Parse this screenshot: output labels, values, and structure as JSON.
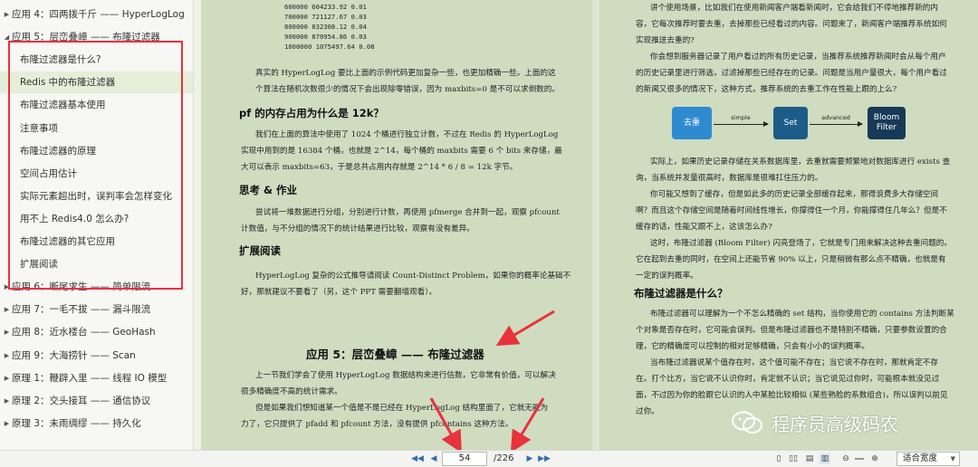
{
  "toc": {
    "items": [
      {
        "label": "应用 4：四两拨千斤 —— HyperLogLog",
        "arrow": "▶",
        "level": 0
      },
      {
        "label": "应用 5：层峦叠嶂 —— 布隆过滤器",
        "arrow": "◢",
        "level": 0
      },
      {
        "label": "布隆过滤器是什么?",
        "level": 1
      },
      {
        "label": "Redis 中的布隆过滤器",
        "level": 1,
        "active": true
      },
      {
        "label": "布隆过滤器基本使用",
        "level": 1
      },
      {
        "label": "注意事项",
        "level": 1
      },
      {
        "label": "布隆过滤器的原理",
        "level": 1
      },
      {
        "label": "空间占用估计",
        "level": 1
      },
      {
        "label": "实际元素超出时，误判率会怎样变化",
        "level": 1
      },
      {
        "label": "用不上 Redis4.0 怎么办?",
        "level": 1
      },
      {
        "label": "布隆过滤器的其它应用",
        "level": 1
      },
      {
        "label": "扩展阅读",
        "level": 1
      },
      {
        "label": "应用 6：断尾求生 —— 简单限流",
        "arrow": "▶",
        "level": 0
      },
      {
        "label": "应用 7：一毛不拔 —— 漏斗限流",
        "arrow": "▶",
        "level": 0
      },
      {
        "label": "应用 8：近水楼台 —— GeoHash",
        "arrow": "▶",
        "level": 0
      },
      {
        "label": "应用 9：大海捞针 —— Scan",
        "arrow": "▶",
        "level": 0
      },
      {
        "label": "原理 1：鞭辟入里 —— 线程 IO 模型",
        "arrow": "▶",
        "level": 0
      },
      {
        "label": "原理 2：交头接耳 —— 通信协议",
        "arrow": "▶",
        "level": 0
      },
      {
        "label": "原理 3：未雨绸缪 —— 持久化",
        "arrow": "▶",
        "level": 0
      }
    ]
  },
  "left_page": {
    "code_lines": [
      "600000 604233.92 0.01",
      "700000 721127.67 0.03",
      "800000 832308.12 0.04",
      "900000 870954.86 0.03",
      "1000000 1075497.64 0.08"
    ],
    "para1": [
      "真实的 HyperLogLog 要比上面的示例代码更加复杂一些，也更加精确一些。上面的这",
      "个算法在随机次数很少的情况下会出现除零错误，因为 maxbits=0 是不可以求倒数的。"
    ],
    "heading_pf": "pf 的内存占用为什么是 12k？",
    "para2": [
      "我们在上面的算法中使用了 1024 个桶进行独立计数，不过在 Redis 的 HyperLogLog",
      "实现中用到的是 16384 个桶，也就是 2^14，每个桶的 maxbits 需要 6 个 bits 来存储，最",
      "大可以表示 maxbits=63，于是总共占用内存就是 2^14 * 6 / 8 = 12k 字节。"
    ],
    "heading_think": "思考 & 作业",
    "para3": [
      "尝试将一堆数据进行分组，分别进行计数，再使用 pfmerge 合并到一起，观察 pfcount",
      "计数值，与不分组的情况下的统计结果进行比较，观察有没有差异。"
    ],
    "heading_ext": "扩展阅读",
    "para4": [
      "HyperLogLog 复杂的公式推导请阅读 Count-Distinct Problem，如果你的概率论基础不",
      "好，那就建议不要看了（另，这个 PPT 需要翻墙观看）。"
    ],
    "chapter_title": "应用 5：层峦叠嶂 —— 布隆过滤器",
    "para5": [
      "上一节我们学会了使用 HyperLogLog 数据结构来进行估数，它非常有价值，可以解决",
      "很多精确度不高的统计需求。",
      "但是如果我们想知道某一个值是不是已经在 HyperLogLog 结构里面了，它就无能为",
      "力了，它只提供了 pfadd 和 pfcount 方法，没有提供 pfcontains 这种方法。"
    ]
  },
  "right_page": {
    "para1": [
      "讲个使用场景，比如我们在使用新闻客户端看新闻时，它会给我们不停地推荐新的内",
      "容，它每次推荐时要去重，去掉那些已经看过的内容。问题来了，新闻客户端推荐系统如何",
      "实现推送去重的?",
      "你会想到服务器记录了用户看过的所有历史记录，当推荐系统推荐新闻时会从每个用户",
      "的历史记录里进行筛选，过滤掉那些已经存在的记录。问题是当用户量很大，每个用户看过",
      "的新闻又很多的情况下，这种方式，推荐系统的去重工作在性能上跟的上么?"
    ],
    "diagram": {
      "box1": "去重",
      "box2": "Set",
      "box3": "Bloom\nFilter",
      "arrow1": "simple",
      "arrow2": "advanced",
      "color1": "#2f8bd0",
      "color2": "#1d5c89",
      "color3": "#163a57"
    },
    "para2": [
      "实际上，如果历史记录存储在关系数据库里，去重就需要频繁地对数据库进行 exists 查",
      "询，当系统并发量很高时，数据库是很难扛住压力的。",
      "你可能又想到了缓存，但是如此多的历史记录全部缓存起来，那得浪费多大存储空间",
      "啊？而且这个存储空间是随着时间线性增长，你撑得住一个月，你能撑得住几年么？但是不",
      "缓存的话，性能又跟不上，这该怎么办?",
      "这时，布隆过滤器 (Bloom Filter) 闪亮登场了，它就是专门用来解决这种去重问题的。",
      "它在起到去重的同时，在空间上还能节省 90% 以上，只是稍微有那么点不精确，也就是有",
      "一定的误判概率。"
    ],
    "heading": "布隆过滤器是什么？",
    "para3": [
      "布隆过滤器可以理解为一个不怎么精确的 set 结构，当你使用它的 contains 方法判断某",
      "个对象是否存在时，它可能会误判。但是布隆过滤器也不是特别不精确，只要参数设置的合",
      "理，它的精确度可以控制的相对足够精确，只会有小小的误判概率。",
      "当布隆过滤器说某个值存在时，这个值可能不存在；当它说不存在时，那就肯定不存",
      "在。打个比方，当它说不认识你时，肯定就不认识；当它说见过你时，可能根本就没见过",
      "面，不过因为你的脸跟它认识的人中某脸比较相似 (某些熟脸的系数组合)，所以误判以前见",
      "过你。"
    ]
  },
  "watermark": "程序员高级码农",
  "bottom": {
    "first_btn": "◀◀",
    "prev_btn": "◀",
    "page": "54",
    "total": "/226",
    "next_btn": "▶",
    "last_btn": "▶▶",
    "zoom": "适合宽度",
    "zoom_minus": "⊖",
    "zoom_plus": "⊕"
  },
  "colors": {
    "highlight_box": "#e8323c",
    "page_bg": "#cfdcc0",
    "nav_blue": "#2f6fb3"
  }
}
